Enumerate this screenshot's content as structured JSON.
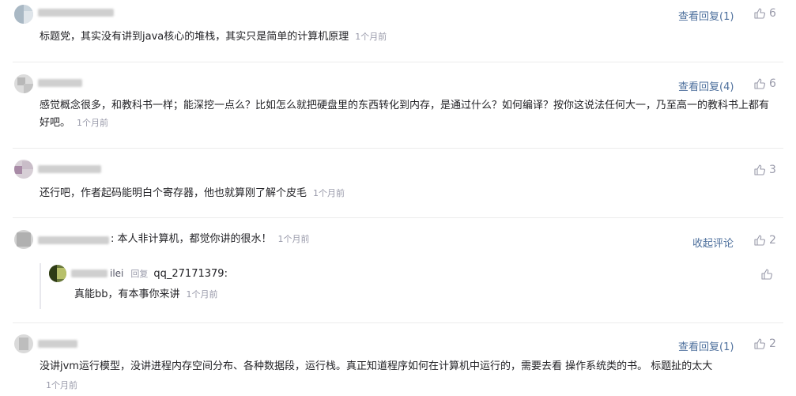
{
  "comments": [
    {
      "text": "标题党，其实没有讲到java核心的堆栈，其实只是简单的计算机原理",
      "time": "1个月前",
      "reply_link": "查看回复(1)",
      "likes": "6"
    },
    {
      "text": "感觉概念很多，和教科书一样；能深挖一点么？比如怎么就把硬盘里的东西转化到内存，是通过什么？如何编译？按你这说法任何大一，乃至高一的教科书上都有好吧。",
      "time": "1个月前",
      "reply_link": "查看回复(4)",
      "likes": "6"
    },
    {
      "text": "还行吧，作者起码能明白个寄存器，他也就算刚了解个皮毛",
      "time": "1个月前",
      "likes": "3"
    },
    {
      "text": "本人非计算机，都觉你讲的很水！",
      "time": "1个月前",
      "reply_link": "收起评论",
      "likes": "2",
      "reply": {
        "user_suffix": "ilei",
        "reply_label": "回复",
        "target_user": "qq_27171379:",
        "text": "真能bb，有本事你来讲",
        "time": "1个月前"
      }
    },
    {
      "text": "没讲jvm运行模型，没讲进程内存空间分布、各种数据段，运行栈。真正知道程序如何在计算机中运行的，需要去看 操作系统类的书。 标题扯的太大",
      "time": "1个月前",
      "reply_link": "查看回复(1)",
      "likes": "2"
    }
  ],
  "colors": {
    "link": "#4d6f9c",
    "muted": "#999aaa",
    "text": "#222226"
  },
  "icons": {
    "like": "thumbs-up-icon"
  }
}
